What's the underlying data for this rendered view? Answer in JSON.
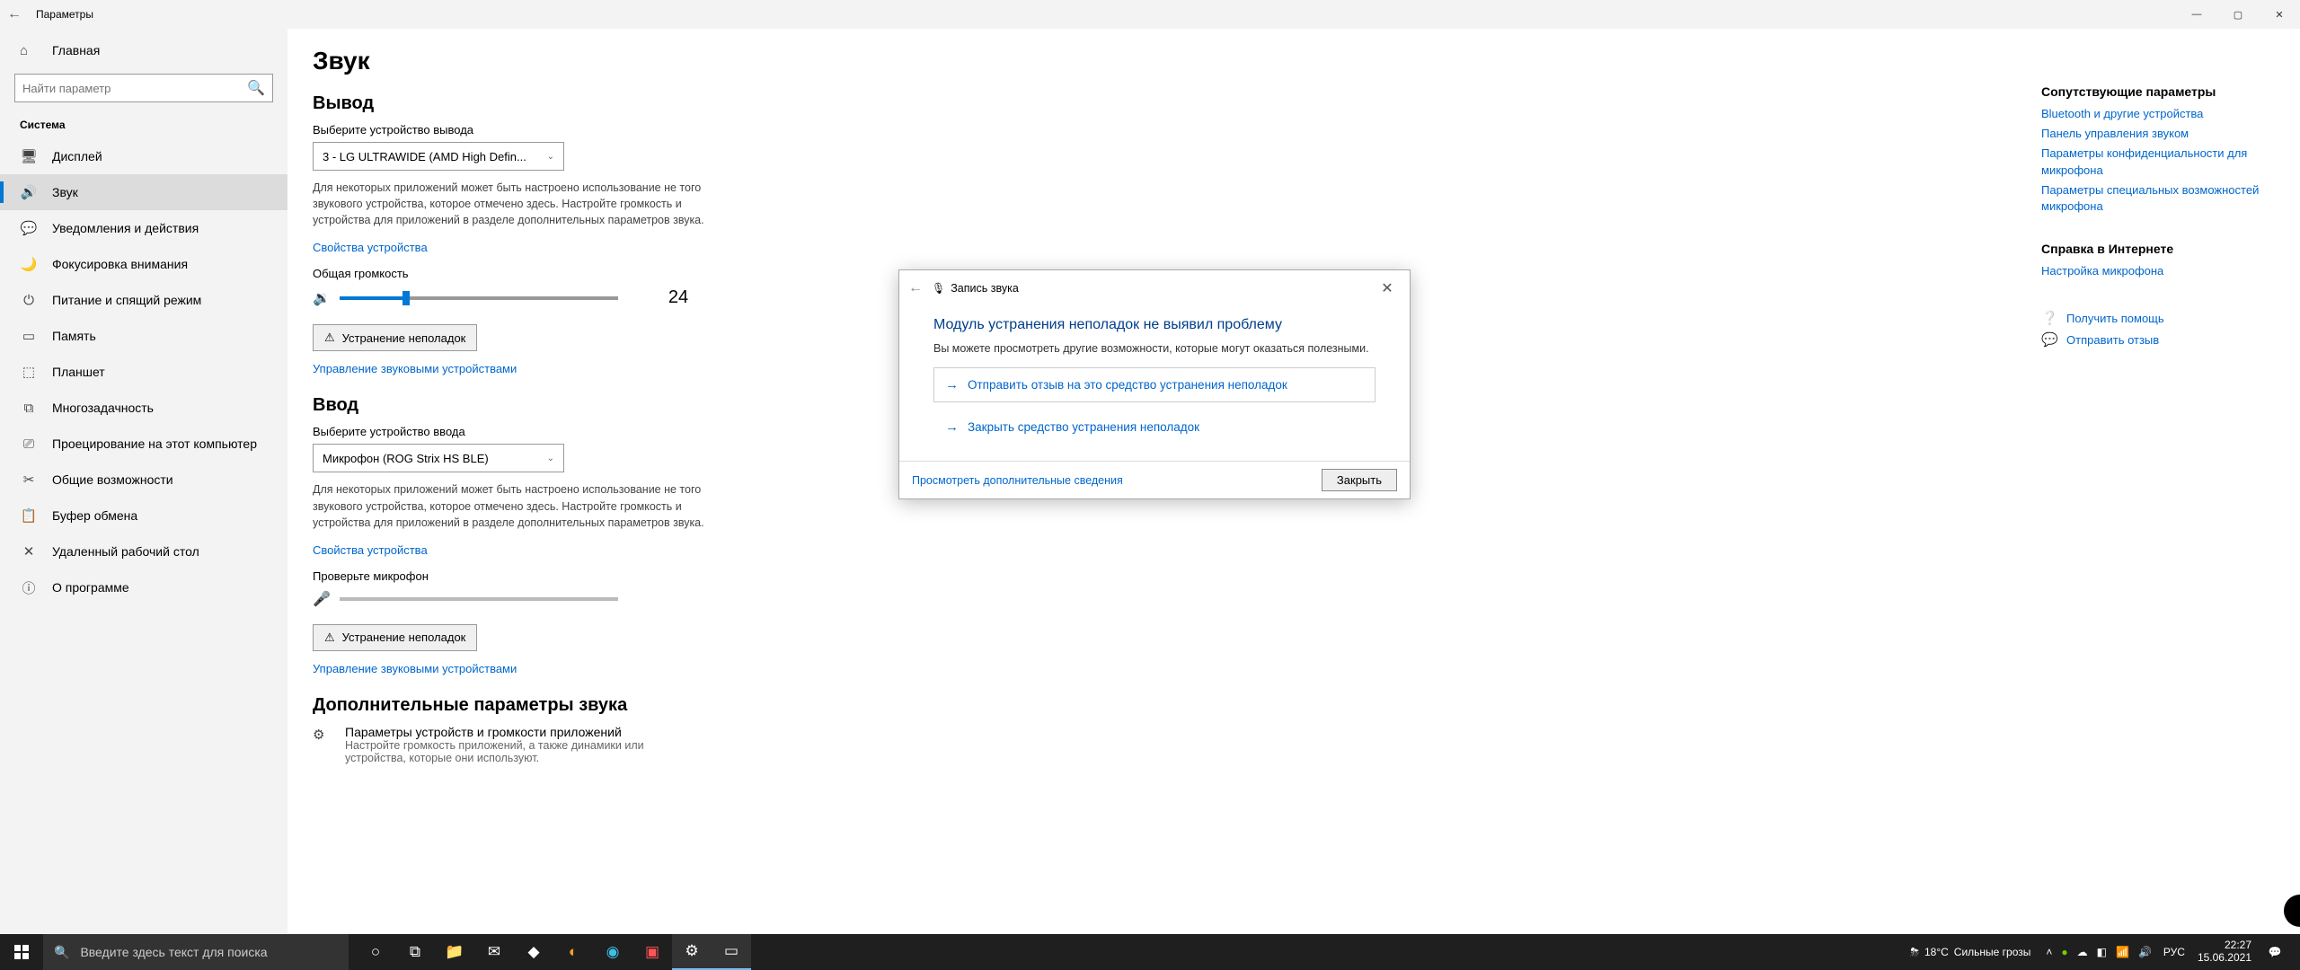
{
  "titlebar": {
    "title": "Параметры"
  },
  "home_label": "Главная",
  "search_placeholder": "Найти параметр",
  "section_label": "Система",
  "nav": [
    {
      "icon": "🖥",
      "label": "Дисплей"
    },
    {
      "icon": "🔊",
      "label": "Звук",
      "active": true
    },
    {
      "icon": "💬",
      "label": "Уведомления и действия"
    },
    {
      "icon": "🌙",
      "label": "Фокусировка внимания"
    },
    {
      "icon": "⏻",
      "label": "Питание и спящий режим"
    },
    {
      "icon": "▭",
      "label": "Память"
    },
    {
      "icon": "⬚",
      "label": "Планшет"
    },
    {
      "icon": "⧉",
      "label": "Многозадачность"
    },
    {
      "icon": "⎚",
      "label": "Проецирование на этот компьютер"
    },
    {
      "icon": "✂",
      "label": "Общие возможности"
    },
    {
      "icon": "📋",
      "label": "Буфер обмена"
    },
    {
      "icon": "✕",
      "label": "Удаленный рабочий стол"
    },
    {
      "icon": "ⓘ",
      "label": "О программе"
    }
  ],
  "page_title": "Звук",
  "output": {
    "heading": "Вывод",
    "device_label": "Выберите устройство вывода",
    "device_value": "3 - LG ULTRAWIDE (AMD High Defin...",
    "desc": "Для некоторых приложений может быть настроено использование не того звукового устройства, которое отмечено здесь. Настройте громкость и устройства для приложений в разделе дополнительных параметров звука.",
    "props_link": "Свойства устройства",
    "volume_label": "Общая громкость",
    "volume_value": "24",
    "volume_pct": 24,
    "troubleshoot": "Устранение неполадок",
    "manage_link": "Управление звуковыми устройствами"
  },
  "input": {
    "heading": "Ввод",
    "device_label": "Выберите устройство ввода",
    "device_value": "Микрофон (ROG Strix HS BLE)",
    "desc": "Для некоторых приложений может быть настроено использование не того звукового устройства, которое отмечено здесь. Настройте громкость и устройства для приложений в разделе дополнительных параметров звука.",
    "props_link": "Свойства устройства",
    "check_label": "Проверьте микрофон",
    "troubleshoot": "Устранение неполадок",
    "manage_link": "Управление звуковыми устройствами"
  },
  "advanced": {
    "heading": "Дополнительные параметры звука",
    "row_title": "Параметры устройств и громкости приложений",
    "row_sub": "Настройте громкость приложений, а также динамики или устройства, которые они используют."
  },
  "right": {
    "related_head": "Сопутствующие параметры",
    "links": [
      "Bluetooth и другие устройства",
      "Панель управления звуком",
      "Параметры конфиденциальности для микрофона",
      "Параметры специальных возможностей микрофона"
    ],
    "help_head": "Справка в Интернете",
    "help_link": "Настройка микрофона",
    "get_help": "Получить помощь",
    "feedback": "Отправить отзыв"
  },
  "dialog": {
    "breadcrumb": "Запись звука",
    "heading": "Модуль устранения неполадок не выявил проблему",
    "sub": "Вы можете просмотреть другие возможности, которые могут оказаться полезными.",
    "opt1": "Отправить отзыв на это средство устранения неполадок",
    "opt2": "Закрыть средство устранения неполадок",
    "more": "Просмотреть дополнительные сведения",
    "close": "Закрыть"
  },
  "taskbar": {
    "search_placeholder": "Введите здесь текст для поиска",
    "weather_temp": "18°C",
    "weather_text": "Сильные грозы",
    "lang": "РУС",
    "time": "22:27",
    "date": "15.06.2021"
  }
}
